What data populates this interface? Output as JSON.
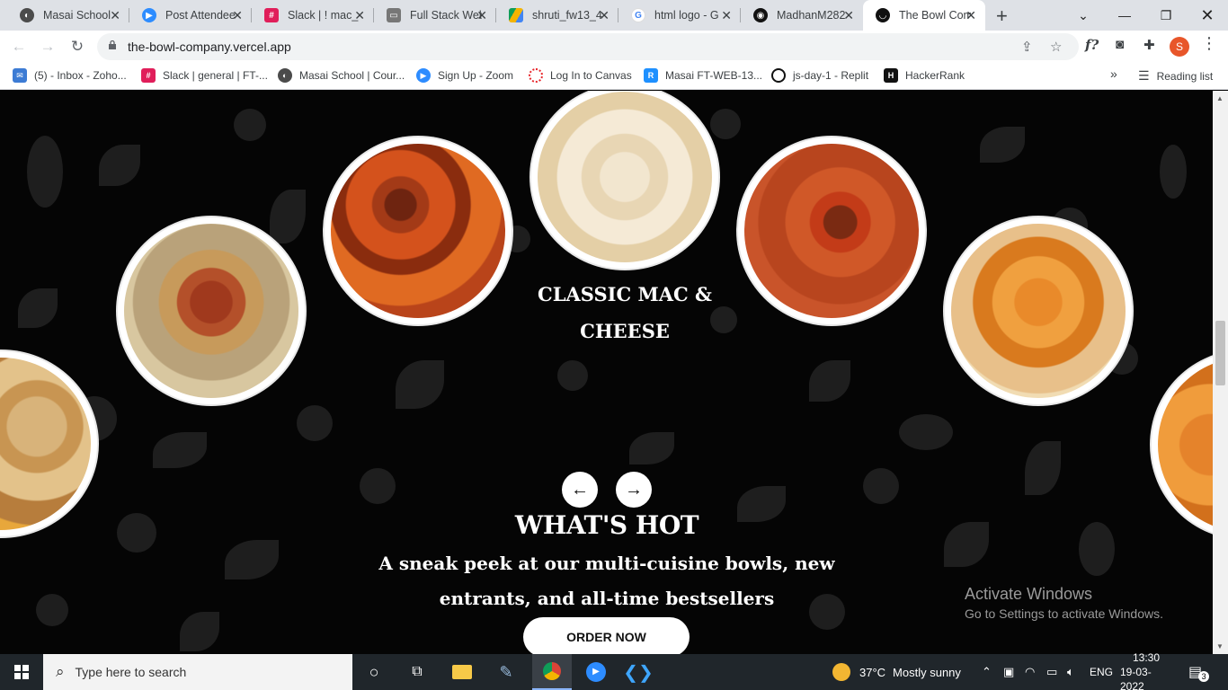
{
  "browser": {
    "tabs": [
      {
        "label": "Masai School",
        "icon": "masai-icon",
        "color": "#4b4b4b"
      },
      {
        "label": "Post Attendee",
        "icon": "zoom-icon",
        "color": "#2d8cff"
      },
      {
        "label": "Slack | ! mac_",
        "icon": "slack-icon",
        "color": "#e01e5a"
      },
      {
        "label": "Full Stack Web",
        "icon": "car-icon",
        "color": "#777777"
      },
      {
        "label": "shruti_fw13_4",
        "icon": "drive-icon",
        "color": "#0f9d58"
      },
      {
        "label": "html logo - G",
        "icon": "google-icon",
        "color": "#4285f4"
      },
      {
        "label": "MadhanM282",
        "icon": "github-icon",
        "color": "#111111"
      },
      {
        "label": "The Bowl Com",
        "icon": "bowl-company-icon",
        "color": "#111111"
      }
    ],
    "url": "the-bowl-company.vercel.app",
    "profile_initial": "S",
    "extension_label": "f?"
  },
  "bookmarks": {
    "items": [
      {
        "label": "(5) - Inbox - Zoho...",
        "icon": "zoho-mail-icon",
        "color": "#3c7bd4"
      },
      {
        "label": "Slack | general | FT-...",
        "icon": "slack-icon",
        "color": "#e01e5a"
      },
      {
        "label": "Masai School | Cour...",
        "icon": "masai-icon",
        "color": "#4b4b4b"
      },
      {
        "label": "Sign Up - Zoom",
        "icon": "zoom-icon",
        "color": "#2d8cff"
      },
      {
        "label": "Log In to Canvas",
        "icon": "canvas-icon",
        "color": "#e72429"
      },
      {
        "label": "Masai FT-WEB-13...",
        "icon": "masai-ft-icon",
        "color": "#1e90ff"
      },
      {
        "label": "js-day-1 - Replit",
        "icon": "replit-icon",
        "color": "#111111"
      },
      {
        "label": "HackerRank",
        "icon": "hackerrank-icon",
        "color": "#111111"
      }
    ],
    "overflow": "»",
    "reading_list": "Reading list"
  },
  "page": {
    "dish_title": "CLASSIC MAC & CHEESE",
    "prev_arrow": "←",
    "next_arrow": "→",
    "section_title": "WHAT'S HOT",
    "section_subtitle": "A sneak peek at our multi-cuisine bowls, new entrants, and all-time bestsellers",
    "cta": "ORDER NOW"
  },
  "watermark": {
    "line1": "Activate Windows",
    "line2": "Go to Settings to activate Windows."
  },
  "taskbar": {
    "search_placeholder": "Type here to search",
    "weather_temp": "37°C",
    "weather_text": "Mostly sunny",
    "language": "ENG",
    "time": "13:30",
    "date": "19-03-2022",
    "notifications": "3"
  }
}
